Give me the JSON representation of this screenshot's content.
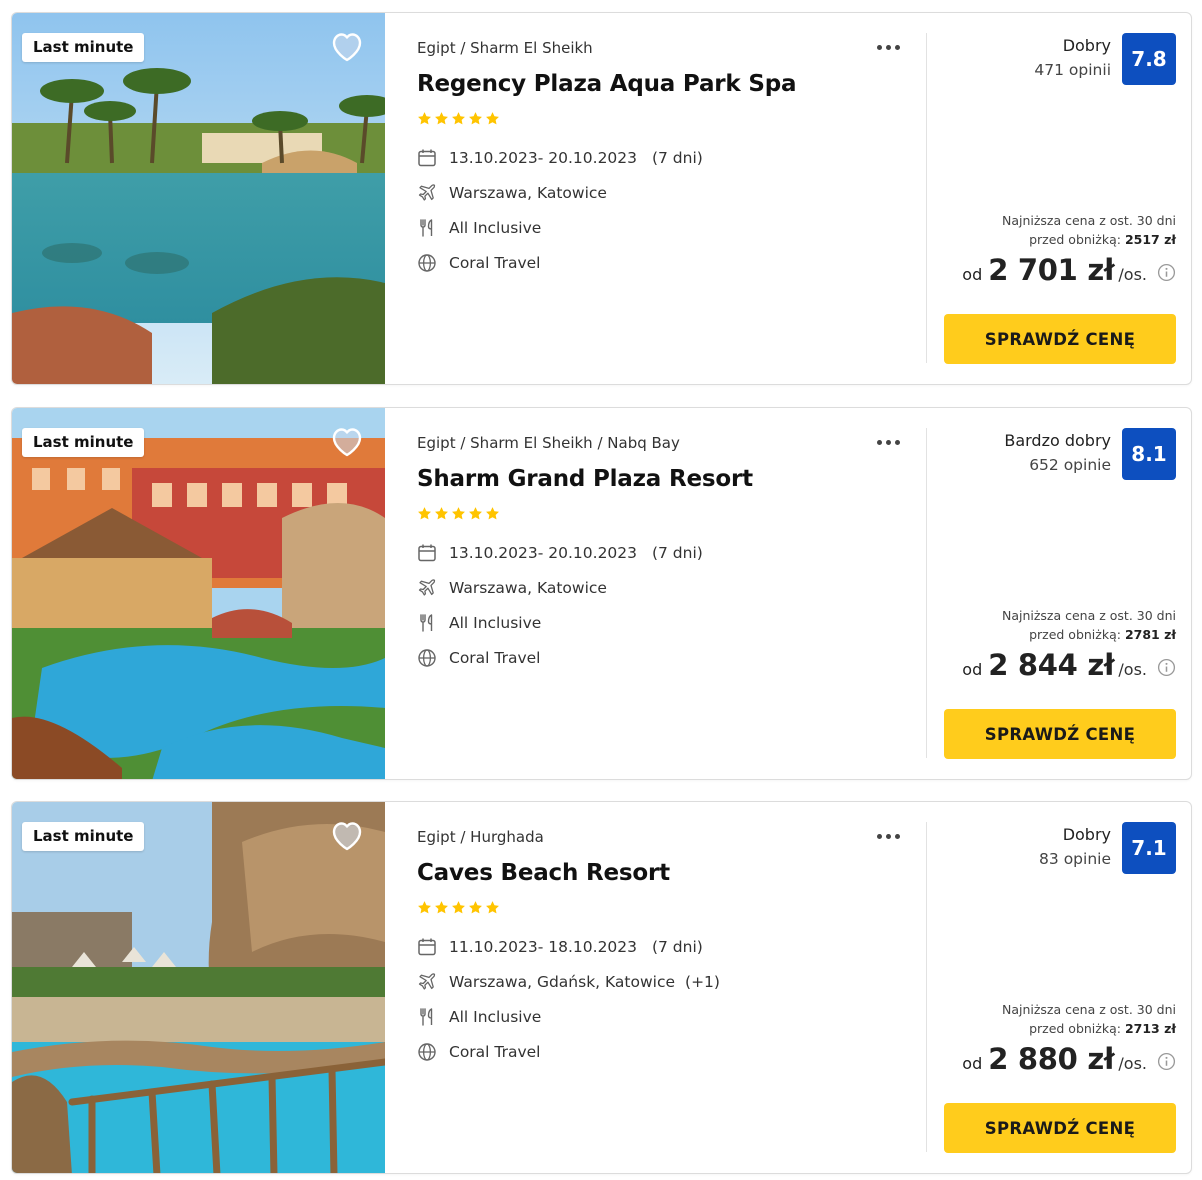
{
  "offers": [
    {
      "badge": "Last minute",
      "location": "Egipt / Sharm El Sheikh",
      "name": "Regency Plaza Aqua Park Spa",
      "stars": 5,
      "dates": "13.10.2023- 20.10.2023",
      "duration": "(7 dni)",
      "departure": "Warszawa, Katowice",
      "departure_extra": "",
      "board": "All Inclusive",
      "operator": "Coral Travel",
      "rating_label": "Dobry",
      "rating_count": "471 opinii",
      "score": "7.8",
      "lowest_line1": "Najniższa cena z ost. 30 dni",
      "lowest_line2": "przed obniżką:",
      "lowest_value": "2517 zł",
      "price_prefix": "od",
      "price": "2 701 zł",
      "price_suffix": "/os.",
      "cta": "SPRAWDŹ CENĘ"
    },
    {
      "badge": "Last minute",
      "location": "Egipt / Sharm El Sheikh / Nabq Bay",
      "name": "Sharm Grand Plaza Resort",
      "stars": 5,
      "dates": "13.10.2023- 20.10.2023",
      "duration": "(7 dni)",
      "departure": "Warszawa, Katowice",
      "departure_extra": "",
      "board": "All Inclusive",
      "operator": "Coral Travel",
      "rating_label": "Bardzo dobry",
      "rating_count": "652 opinie",
      "score": "8.1",
      "lowest_line1": "Najniższa cena z ost. 30 dni",
      "lowest_line2": "przed obniżką:",
      "lowest_value": "2781 zł",
      "price_prefix": "od",
      "price": "2 844 zł",
      "price_suffix": "/os.",
      "cta": "SPRAWDŹ CENĘ"
    },
    {
      "badge": "Last minute",
      "location": "Egipt / Hurghada",
      "name": "Caves Beach Resort",
      "stars": 5,
      "dates": "11.10.2023- 18.10.2023",
      "duration": "(7 dni)",
      "departure": "Warszawa, Gdańsk, Katowice",
      "departure_extra": "(+1)",
      "board": "All Inclusive",
      "operator": "Coral Travel",
      "rating_label": "Dobry",
      "rating_count": "83 opinie",
      "score": "7.1",
      "lowest_line1": "Najniższa cena z ost. 30 dni",
      "lowest_line2": "przed obniżką:",
      "lowest_value": "2713 zł",
      "price_prefix": "od",
      "price": "2 880 zł",
      "price_suffix": "/os.",
      "cta": "SPRAWDŹ CENĘ"
    }
  ],
  "icons": {
    "favorite": "heart-icon",
    "more": "more-dots-icon",
    "dates": "calendar-icon",
    "departure": "plane-icon",
    "board": "cutlery-icon",
    "operator": "globe-icon",
    "price_info": "info-icon",
    "rating": "star-icon"
  },
  "colors": {
    "score_bg": "#0d4fbf",
    "cta_bg": "#ffcc1c",
    "star": "#ffc400"
  }
}
